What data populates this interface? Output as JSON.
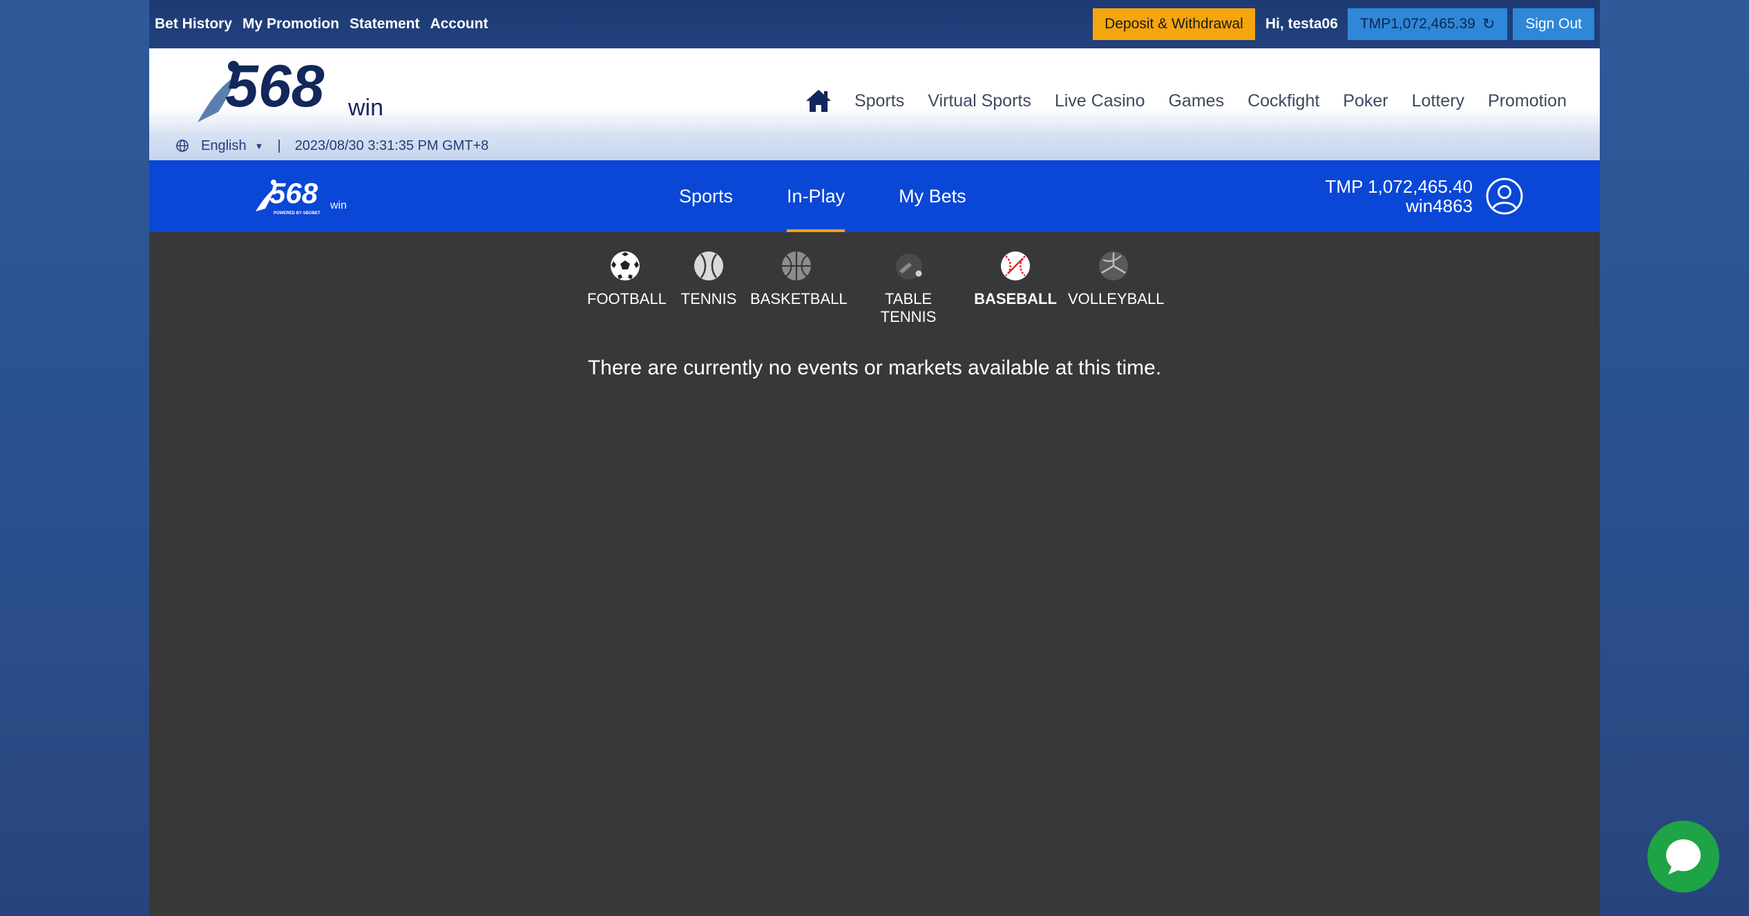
{
  "topbar": {
    "links": [
      "Bet History",
      "My Promotion",
      "Statement",
      "Account"
    ],
    "deposit_label": "Deposit & Withdrawal",
    "greeting": "Hi, testa06",
    "balance": "TMP1,072,465.39",
    "refresh_icon": "refresh-icon",
    "signout_label": "Sign Out",
    "colors": {
      "deposit": "#f5a50e",
      "balance_bg": "#2f87d8"
    }
  },
  "header": {
    "logo_text": "568",
    "logo_suffix": "win",
    "home_icon": "home-icon",
    "nav": [
      "Sports",
      "Virtual Sports",
      "Live Casino",
      "Games",
      "Cockfight",
      "Poker",
      "Lottery",
      "Promotion"
    ]
  },
  "strip": {
    "globe_icon": "globe-icon",
    "language": "English",
    "datetime": "2023/08/30 3:31:35 PM GMT+8"
  },
  "sportsbar": {
    "logo_text": "568",
    "logo_suffix": "win",
    "logo_tagline": "POWERED BY SBOBET",
    "tabs": [
      {
        "label": "Sports",
        "active": false
      },
      {
        "label": "In-Play",
        "active": true
      },
      {
        "label": "My Bets",
        "active": false
      }
    ],
    "balance": "TMP 1,072,465.40",
    "username": "win4863",
    "user_icon": "user-circle-icon",
    "colors": {
      "bg": "#0a47d6",
      "active_underline": "#f0a21a"
    }
  },
  "sports": [
    {
      "label": "FOOTBALL",
      "icon": "football-icon",
      "active": false
    },
    {
      "label": "TENNIS",
      "icon": "tennis-icon",
      "active": false
    },
    {
      "label": "BASKETBALL",
      "icon": "basketball-icon",
      "active": false
    },
    {
      "label": "TABLE TENNIS",
      "icon": "table-tennis-icon",
      "active": false
    },
    {
      "label": "BASEBALL",
      "icon": "baseball-icon",
      "active": true
    },
    {
      "label": "VOLLEYBALL",
      "icon": "volleyball-icon",
      "active": false
    }
  ],
  "message": "There are currently no events or markets available at this time.",
  "chat": {
    "icon": "chat-bubble-icon",
    "color": "#1fa347"
  }
}
